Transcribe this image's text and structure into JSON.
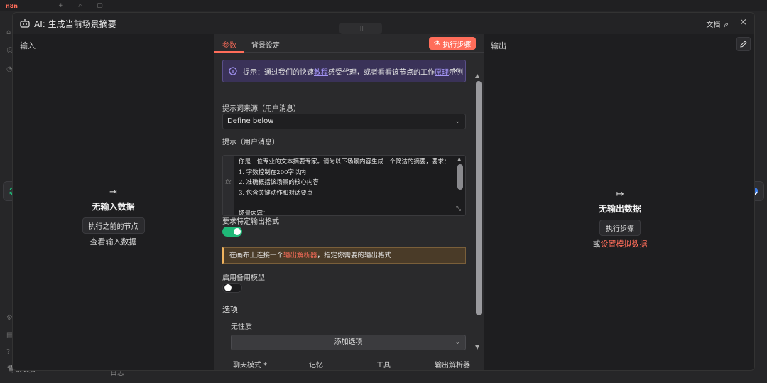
{
  "modal": {
    "title": "AI: 生成当前场景摘要",
    "docs_label": "文档",
    "close_glyph": "×"
  },
  "input_panel": {
    "label": "输入",
    "empty_title": "无输入数据",
    "run_prev_button": "执行之前的节点",
    "view_input_link": "查看输入数据"
  },
  "output_panel": {
    "label": "输出",
    "empty_title": "无输出数据",
    "run_step_button": "执行步骤",
    "or_label": "或",
    "mock_data_link": "设置模拟数据"
  },
  "center": {
    "tabs": [
      {
        "label": "参数",
        "active": true
      },
      {
        "label": "背景设定",
        "active": false
      }
    ],
    "execute_button": "执行步骤",
    "hint": {
      "prefix": "提示：通过我们的快速",
      "link1": "教程",
      "middle": "感受代理，或者看看该节点的工作",
      "link2": "原理",
      "suffix": "示例"
    },
    "prompt_source_label": "提示词来源（用户消息）",
    "prompt_source_value": "Define below",
    "prompt_label": "提示（用户消息）",
    "prompt_lines": [
      "你是一位专业的文本摘要专家。请为以下场景内容生成一个简洁的摘要，要求：",
      "1. 字数控制在200字以内",
      "2. 准确概括该场景的核心内容",
      "3. 包含关键动作和对话要点",
      "",
      "场景内容："
    ],
    "output_format_label": "要求特定输出格式",
    "output_format_on": true,
    "warning": {
      "prefix": "在画布上连接一个",
      "link": "输出解析器",
      "suffix": "，指定你需要的输出格式"
    },
    "fallback_label": "启用备用模型",
    "fallback_on": false,
    "options_title": "选项",
    "no_options": "无性质",
    "add_option": "添加选项",
    "sub_nodes": [
      "聊天模式 *",
      "记忆",
      "工具",
      "输出解析器"
    ]
  },
  "background_app": {
    "bottom_label": "背景设定",
    "log_label": "日志"
  },
  "colors": {
    "accent": "#ff6d5a",
    "toggle_on": "#1fb978",
    "hint_bg": "#3a3258",
    "warn_border": "#f0b35e"
  }
}
